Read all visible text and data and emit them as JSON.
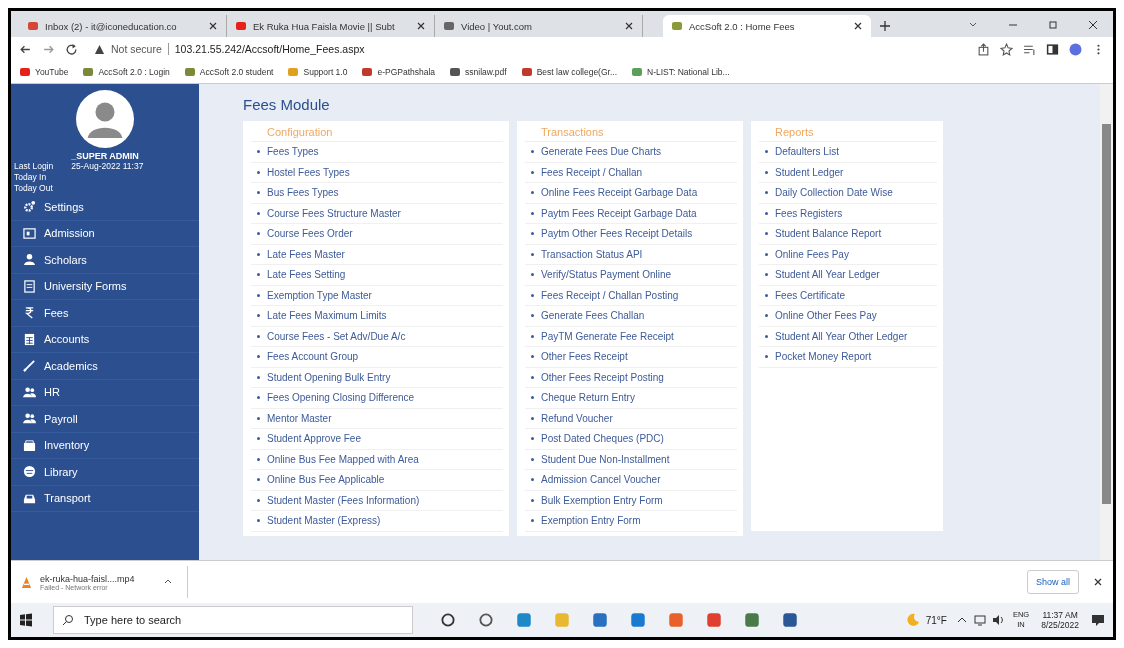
{
  "browser": {
    "tabs": [
      {
        "title": "Inbox (2) - it@iconeducation.co",
        "selected": false
      },
      {
        "title": "Ek Ruka Hua Faisla Movie || Subt",
        "selected": false
      },
      {
        "title": "Video | Yout.com",
        "selected": false
      },
      {
        "title": "AccSoft 2.0 : Home Fees",
        "selected": true
      }
    ],
    "address": {
      "security": "Not secure",
      "url": "103.21.55.242/Accsoft/Home_Fees.aspx"
    },
    "bookmarks": [
      "YouTube",
      "AccSoft 2.0 : Login",
      "AccSoft 2.0 student",
      "Support 1.0",
      "e-PGPathshala",
      "ssnilaw.pdf",
      "Best law college(Gr...",
      "N-LIST: National Lib..."
    ]
  },
  "sidebar": {
    "user": "_SUPER ADMIN",
    "login_info": [
      {
        "label": "Last Login",
        "value": "25-Aug-2022 11:37"
      },
      {
        "label": "Today In"
      },
      {
        "label": "Today Out"
      }
    ],
    "items": [
      "Settings",
      "Admission",
      "Scholars",
      "University Forms",
      "Fees",
      "Accounts",
      "Academics",
      "HR",
      "Payroll",
      "Inventory",
      "Library",
      "Transport"
    ]
  },
  "page": {
    "title": "Fees Module",
    "sections": [
      {
        "heading": "Configuration",
        "links": [
          "Fees Types",
          "Hostel Fees Types",
          "Bus Fees Types",
          "Course Fees Structure Master",
          "Course Fees Order",
          "Late Fees Master",
          "Late Fees Setting",
          "Exemption Type Master",
          "Late Fees Maximum Limits",
          "Course Fees - Set Adv/Due A/c",
          "Fees Account Group",
          "Student Opening Bulk Entry",
          "Fees Opening Closing Difference",
          "Mentor Master",
          "Student Approve Fee",
          "Online Bus Fee Mapped with Area",
          "Online Bus Fee Applicable",
          "Student Master (Fees Information)",
          "Student Master (Express)"
        ]
      },
      {
        "heading": "Transactions",
        "links": [
          "Generate Fees Due Charts",
          "Fees Receipt / Challan",
          "Online Fees Receipt Garbage Data",
          "Paytm Fees Receipt Garbage Data",
          "Paytm Other Fees Receipt Details",
          "Transaction Status API",
          "Verify/Status Payment Online",
          "Fees Receipt / Challan Posting",
          "Generate Fees Challan",
          "PayTM Generate Fee Receipt",
          "Other Fees Receipt",
          "Other Fees Receipt Posting",
          "Cheque Return Entry",
          "Refund Voucher",
          "Post Dated Cheques (PDC)",
          "Student Due Non-Installment",
          "Admission Cancel Voucher",
          "Bulk Exemption Entry Form",
          "Exemption Entry Form"
        ]
      },
      {
        "heading": "Reports",
        "links": [
          "Defaulters List",
          "Student Ledger",
          "Daily Collection Date Wise",
          "Fees Registers",
          "Student Balance Report",
          "Online Fees Pay",
          "Student All Year Ledger",
          "Fees Certificate",
          "Online Other Fees Pay",
          "Student All Year Other Ledger",
          "Pocket Money Report"
        ]
      }
    ]
  },
  "download": {
    "file": "ek-ruka-hua-faisl....mp4",
    "status": "Failed - Network error",
    "show_all": "Show all"
  },
  "taskbar": {
    "search_placeholder": "Type here to search",
    "temperature": "71°F",
    "language": "ENG",
    "region": "IN",
    "time": "11:37 AM",
    "date": "8/25/2022"
  }
}
